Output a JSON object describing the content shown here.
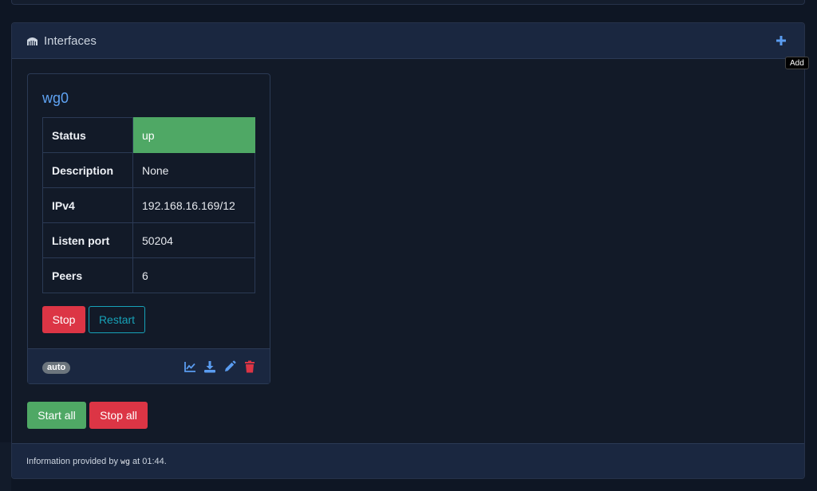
{
  "panel": {
    "title": "Interfaces",
    "add_tooltip": "Add"
  },
  "interface": {
    "name": "wg0",
    "rows": [
      {
        "key": "Status",
        "value": "up"
      },
      {
        "key": "Description",
        "value": "None"
      },
      {
        "key": "IPv4",
        "value": "192.168.16.169/12"
      },
      {
        "key": "Listen port",
        "value": "50204"
      },
      {
        "key": "Peers",
        "value": "6"
      }
    ],
    "stop_label": "Stop",
    "restart_label": "Restart",
    "badge": "auto"
  },
  "actions": {
    "start_all": "Start all",
    "stop_all": "Stop all"
  },
  "footer": {
    "prefix": "Information provided by",
    "tool": "wg",
    "suffix": "at 01:44."
  },
  "colors": {
    "accent": "#5fa3f3",
    "success": "#4fa865",
    "danger": "#dc3545",
    "info": "#17a2b8"
  }
}
